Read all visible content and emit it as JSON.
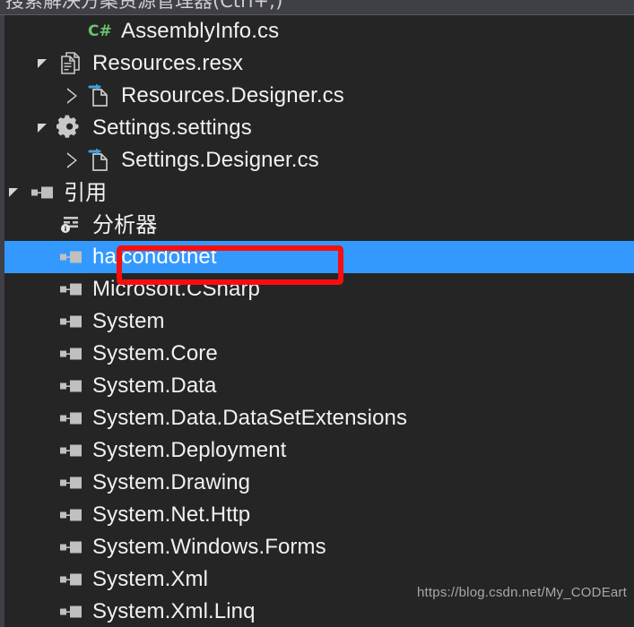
{
  "search": {
    "placeholder": "搜索解决方案资源管理器(Ctrl+;)",
    "value": "搜索解决方案资源管理器(Ctrl+;)"
  },
  "colors": {
    "background": "#252526",
    "selection": "#3399ff",
    "highlight_box": "#fb0d0d",
    "text": "#f1f1f1",
    "gutter": "#3f3f46",
    "csharp_green": "#6ac36a",
    "designer_blue": "#3f9fe0"
  },
  "tree": {
    "items": [
      {
        "label": "AssemblyInfo.cs",
        "icon": "csharp-icon",
        "indent": 2,
        "expander": "none",
        "selected": false,
        "cjk": false
      },
      {
        "label": "Resources.resx",
        "icon": "resx-document-icon",
        "indent": 1,
        "expander": "expanded",
        "selected": false,
        "cjk": false
      },
      {
        "label": "Resources.Designer.cs",
        "icon": "designer-file-icon",
        "indent": 2,
        "expander": "collapsed",
        "selected": false,
        "cjk": false
      },
      {
        "label": "Settings.settings",
        "icon": "gear-icon",
        "indent": 1,
        "expander": "expanded",
        "selected": false,
        "cjk": false
      },
      {
        "label": "Settings.Designer.cs",
        "icon": "designer-file-icon",
        "indent": 2,
        "expander": "collapsed",
        "selected": false,
        "cjk": false
      },
      {
        "label": "引用",
        "icon": "reference-icon",
        "indent": 0,
        "expander": "expanded",
        "selected": false,
        "cjk": true
      },
      {
        "label": "分析器",
        "icon": "analyzer-icon",
        "indent": 1,
        "expander": "none",
        "selected": false,
        "cjk": true
      },
      {
        "label": "halcondotnet",
        "icon": "reference-icon",
        "indent": 1,
        "expander": "none",
        "selected": true,
        "cjk": false
      },
      {
        "label": "Microsoft.CSharp",
        "icon": "reference-icon",
        "indent": 1,
        "expander": "none",
        "selected": false,
        "cjk": false
      },
      {
        "label": "System",
        "icon": "reference-icon",
        "indent": 1,
        "expander": "none",
        "selected": false,
        "cjk": false
      },
      {
        "label": "System.Core",
        "icon": "reference-icon",
        "indent": 1,
        "expander": "none",
        "selected": false,
        "cjk": false
      },
      {
        "label": "System.Data",
        "icon": "reference-icon",
        "indent": 1,
        "expander": "none",
        "selected": false,
        "cjk": false
      },
      {
        "label": "System.Data.DataSetExtensions",
        "icon": "reference-icon",
        "indent": 1,
        "expander": "none",
        "selected": false,
        "cjk": false
      },
      {
        "label": "System.Deployment",
        "icon": "reference-icon",
        "indent": 1,
        "expander": "none",
        "selected": false,
        "cjk": false
      },
      {
        "label": "System.Drawing",
        "icon": "reference-icon",
        "indent": 1,
        "expander": "none",
        "selected": false,
        "cjk": false
      },
      {
        "label": "System.Net.Http",
        "icon": "reference-icon",
        "indent": 1,
        "expander": "none",
        "selected": false,
        "cjk": false
      },
      {
        "label": "System.Windows.Forms",
        "icon": "reference-icon",
        "indent": 1,
        "expander": "none",
        "selected": false,
        "cjk": false
      },
      {
        "label": "System.Xml",
        "icon": "reference-icon",
        "indent": 1,
        "expander": "none",
        "selected": false,
        "cjk": false
      },
      {
        "label": "System.Xml.Linq",
        "icon": "reference-icon",
        "indent": 1,
        "expander": "none",
        "selected": false,
        "cjk": false
      }
    ]
  },
  "watermark": {
    "text": "https://blog.csdn.net/My_CODEart"
  }
}
